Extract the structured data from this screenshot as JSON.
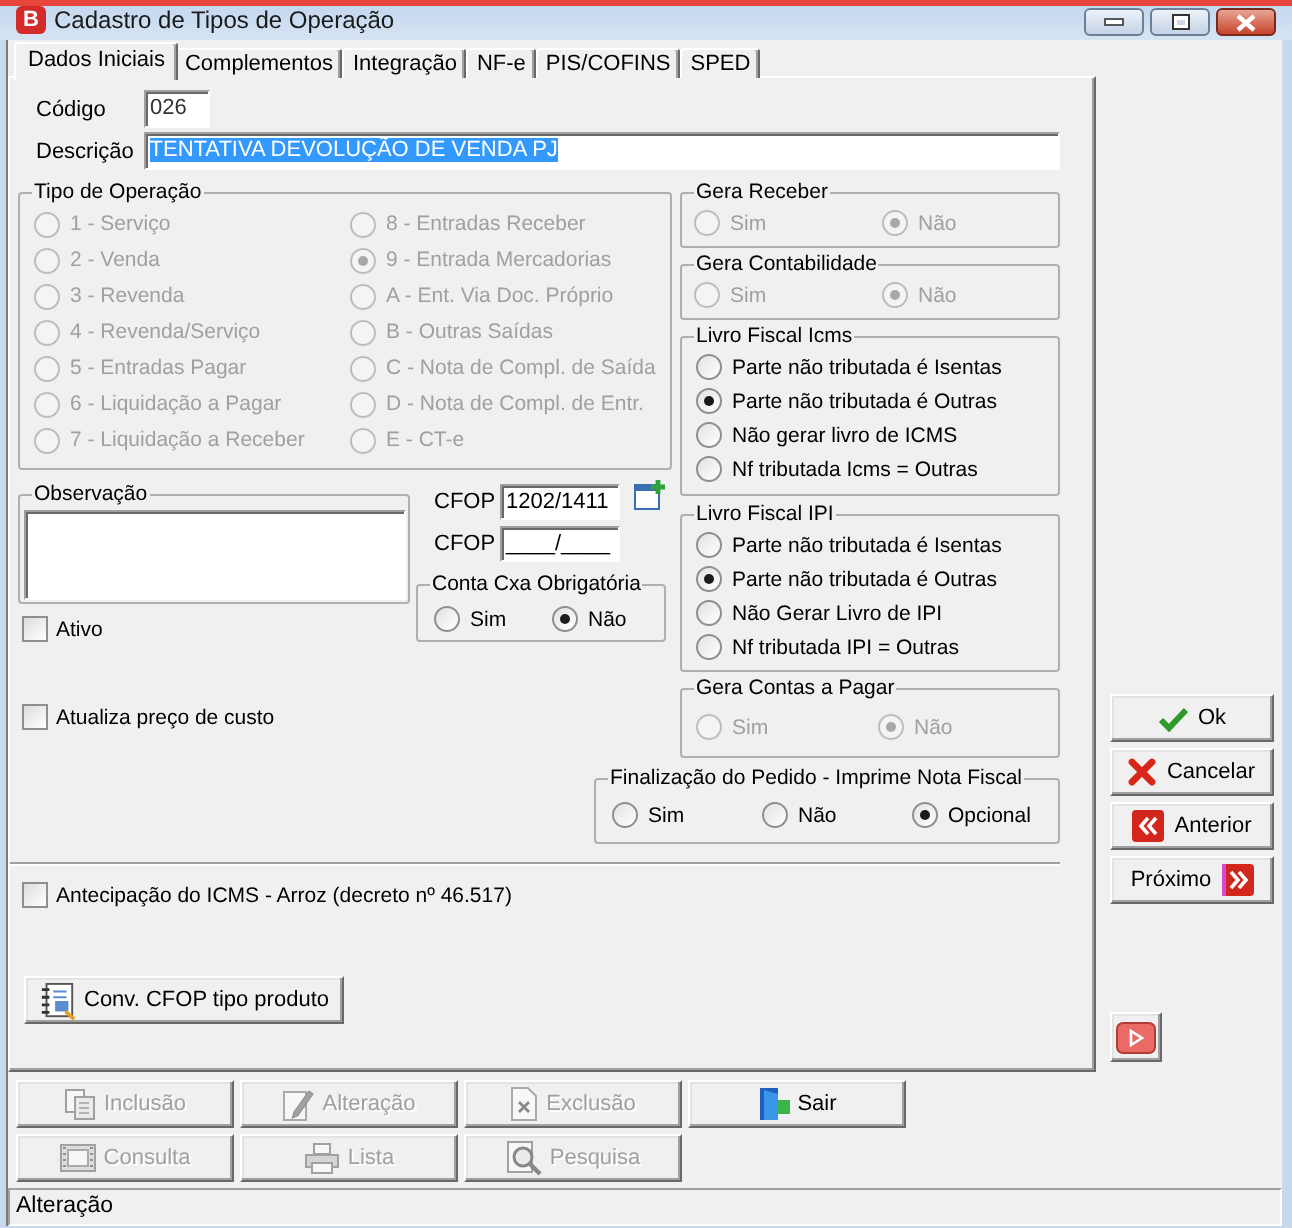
{
  "window": {
    "icon_letter": "B",
    "title": "Cadastro de Tipos de Operação"
  },
  "tabs": [
    {
      "label": "Dados Iniciais",
      "selected": true
    },
    {
      "label": "Complementos",
      "selected": false
    },
    {
      "label": "Integração",
      "selected": false
    },
    {
      "label": "NF-e",
      "selected": false
    },
    {
      "label": "PIS/COFINS",
      "selected": false
    },
    {
      "label": "SPED",
      "selected": false
    }
  ],
  "codigo": {
    "label": "Código",
    "value": "026"
  },
  "descricao": {
    "label": "Descrição",
    "value": "TENTATIVA DEVOLUÇÃO DE VENDA PJ",
    "highlighted": true
  },
  "tipo_operacao": {
    "label": "Tipo de Operação",
    "disabled": true,
    "options": [
      {
        "label": "1 - Serviço",
        "selected": false
      },
      {
        "label": "2 - Venda",
        "selected": false
      },
      {
        "label": "3 - Revenda",
        "selected": false
      },
      {
        "label": "4 - Revenda/Serviço",
        "selected": false
      },
      {
        "label": "5 - Entradas Pagar",
        "selected": false
      },
      {
        "label": "6 - Liquidação a Pagar",
        "selected": false
      },
      {
        "label": "7 - Liquidação a Receber",
        "selected": false
      },
      {
        "label": "8 - Entradas Receber",
        "selected": false
      },
      {
        "label": "9 - Entrada Mercadorias",
        "selected": true
      },
      {
        "label": "A - Ent. Via Doc. Próprio",
        "selected": false
      },
      {
        "label": "B - Outras Saídas",
        "selected": false
      },
      {
        "label": "C - Nota de Compl. de Saída",
        "selected": false
      },
      {
        "label": "D - Nota de Compl. de Entr.",
        "selected": false
      },
      {
        "label": "E - CT-e",
        "selected": false
      }
    ]
  },
  "gera_receber": {
    "label": "Gera Receber",
    "disabled": true,
    "options": [
      {
        "label": "Sim",
        "selected": false
      },
      {
        "label": "Não",
        "selected": true
      }
    ]
  },
  "gera_contabilidade": {
    "label": "Gera Contabilidade",
    "disabled": true,
    "options": [
      {
        "label": "Sim",
        "selected": false
      },
      {
        "label": "Não",
        "selected": true
      }
    ]
  },
  "livro_fiscal_icms": {
    "label": "Livro Fiscal Icms",
    "disabled": false,
    "options": [
      {
        "label": "Parte não tributada é Isentas",
        "selected": false
      },
      {
        "label": "Parte não tributada é Outras",
        "selected": true
      },
      {
        "label": "Não gerar livro de ICMS",
        "selected": false
      },
      {
        "label": "Nf tributada Icms = Outras",
        "selected": false
      }
    ]
  },
  "observacao": {
    "label": "Observação"
  },
  "cfop": [
    {
      "label": "CFOP",
      "value": "1202/1411"
    },
    {
      "label": "CFOP",
      "value": "____/____"
    }
  ],
  "conta_cxa_obrigatoria": {
    "label": "Conta Cxa Obrigatória",
    "disabled": false,
    "options": [
      {
        "label": "Sim",
        "selected": false
      },
      {
        "label": "Não",
        "selected": true
      }
    ]
  },
  "ativo": {
    "label": "Ativo",
    "checked": false
  },
  "livro_fiscal_ipi": {
    "label": "Livro Fiscal IPI",
    "disabled": false,
    "options": [
      {
        "label": "Parte não tributada é Isentas",
        "selected": false
      },
      {
        "label": "Parte não tributada é Outras",
        "selected": true
      },
      {
        "label": "Não Gerar Livro de IPI",
        "selected": false
      },
      {
        "label": "Nf tributada IPI = Outras",
        "selected": false
      }
    ]
  },
  "gera_contas_pagar": {
    "label": "Gera Contas a Pagar",
    "disabled": true,
    "options": [
      {
        "label": "Sim",
        "selected": false
      },
      {
        "label": "Não",
        "selected": true
      }
    ]
  },
  "atualiza_preco_custo": {
    "label": "Atualiza preço de custo",
    "checked": false
  },
  "finalizacao_pedido": {
    "label": "Finalização do Pedido - Imprime Nota Fiscal",
    "disabled": false,
    "options": [
      {
        "label": "Sim",
        "selected": false
      },
      {
        "label": "Não",
        "selected": false
      },
      {
        "label": "Opcional",
        "selected": true
      }
    ]
  },
  "antecipacao_icms": {
    "label": "Antecipação do ICMS - Arroz (decreto nº 46.517)",
    "checked": false
  },
  "conv_cfop_button": {
    "label": "Conv. CFOP tipo produto"
  },
  "side_buttons": [
    {
      "kind": "ok",
      "label": "Ok"
    },
    {
      "kind": "cancel",
      "label": "Cancelar"
    },
    {
      "kind": "previous",
      "label": "Anterior"
    },
    {
      "kind": "next",
      "label": "Próximo"
    }
  ],
  "toolbar": [
    {
      "buttons": [
        {
          "kind": "add",
          "label": "Inclusão",
          "disabled": true
        },
        {
          "kind": "edit",
          "label": "Alteração",
          "disabled": true
        },
        {
          "kind": "delete",
          "label": "Exclusão",
          "disabled": true
        },
        {
          "kind": "exit",
          "label": "Sair",
          "disabled": false
        }
      ]
    },
    {
      "buttons": [
        {
          "kind": "query",
          "label": "Consulta",
          "disabled": true
        },
        {
          "kind": "print",
          "label": "Lista",
          "disabled": true
        },
        {
          "kind": "search",
          "label": "Pesquisa",
          "disabled": true
        }
      ]
    }
  ],
  "status_bar": {
    "text": "Alteração"
  }
}
